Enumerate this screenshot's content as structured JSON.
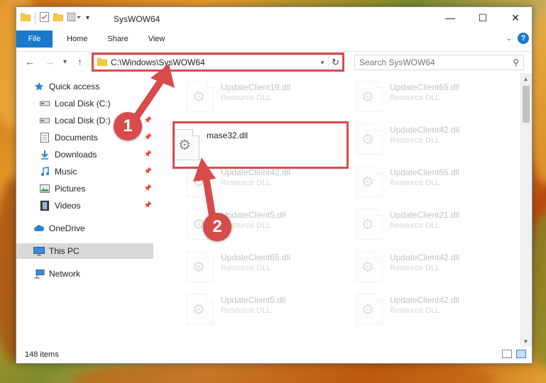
{
  "window": {
    "title": "SysWOW64",
    "controls": {
      "minimize": "—",
      "maximize": "☐",
      "close": "✕"
    }
  },
  "ribbon": {
    "tabs": [
      "File",
      "Home",
      "Share",
      "View"
    ]
  },
  "navbar": {
    "address_path": "C:\\Windows\\SysWOW64",
    "search_placeholder": "Search SysWOW64"
  },
  "sidebar": {
    "items": [
      {
        "label": "Quick access",
        "icon": "star-icon",
        "pinned": false
      },
      {
        "label": "Local Disk (C:)",
        "icon": "drive-icon",
        "pinned": true
      },
      {
        "label": "Local Disk (D:)",
        "icon": "drive-icon",
        "pinned": true
      },
      {
        "label": "Documents",
        "icon": "documents-icon",
        "pinned": true
      },
      {
        "label": "Downloads",
        "icon": "download-icon",
        "pinned": true
      },
      {
        "label": "Music",
        "icon": "music-icon",
        "pinned": true
      },
      {
        "label": "Pictures",
        "icon": "pictures-icon",
        "pinned": true
      },
      {
        "label": "Videos",
        "icon": "videos-icon",
        "pinned": true
      },
      {
        "label": "OneDrive",
        "icon": "cloud-icon",
        "pinned": false
      },
      {
        "label": "This PC",
        "icon": "computer-icon",
        "pinned": false,
        "selected": true
      },
      {
        "label": "Network",
        "icon": "network-icon",
        "pinned": false
      }
    ]
  },
  "files": [
    {
      "name": "UpdateClient19.dll",
      "type": "Resource DLL",
      "faded": true
    },
    {
      "name": "UpdateClient65.dll",
      "type": "Resource DLL",
      "faded": true
    },
    {
      "name": "mase32.dll",
      "type": "",
      "faded": false
    },
    {
      "name": "UpdateClient42.dll",
      "type": "Resource DLL",
      "faded": true
    },
    {
      "name": "UpdateClient42.dll",
      "type": "Resource DLL",
      "faded": true
    },
    {
      "name": "UpdateClient65.dll",
      "type": "Resource DLL",
      "faded": true
    },
    {
      "name": "UpdateClient5.dll",
      "type": "Resource DLL",
      "faded": true
    },
    {
      "name": "UpdateClient21.dll",
      "type": "Resource DLL",
      "faded": true
    },
    {
      "name": "UpdateClient65.dll",
      "type": "Resource DLL",
      "faded": true
    },
    {
      "name": "UpdateClient42.dll",
      "type": "Resource DLL",
      "faded": true
    },
    {
      "name": "UpdateClient5.dll",
      "type": "Resource DLL",
      "faded": true
    },
    {
      "name": "UpdateClient42.dll",
      "type": "Resource DLL",
      "faded": true
    }
  ],
  "status": {
    "item_count": "148 items"
  },
  "callouts": {
    "step1": "1",
    "step2": "2"
  },
  "colors": {
    "accent": "#1979ca",
    "callout": "#d74b4b",
    "selected_bg": "#d9d9d9"
  }
}
